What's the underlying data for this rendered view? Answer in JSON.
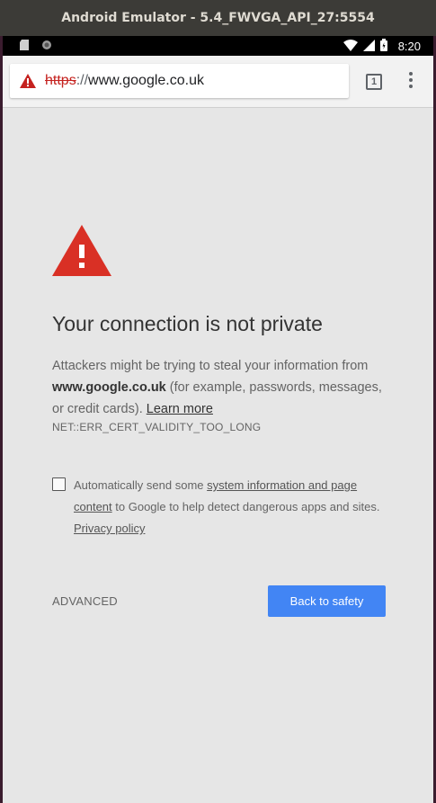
{
  "window": {
    "title": "Android Emulator - 5.4_FWVGA_API_27:5554"
  },
  "status_bar": {
    "time": "8:20",
    "icons": [
      "sd-card-icon",
      "record-icon",
      "wifi-icon",
      "signal-icon",
      "battery-icon"
    ]
  },
  "browser": {
    "url_scheme": "https",
    "url_separator": "://",
    "url_host": "www.google.co.uk",
    "tab_count": "1",
    "icons": [
      "not-secure-warning-icon",
      "tab-switcher-icon",
      "overflow-menu-icon"
    ]
  },
  "interstitial": {
    "heading": "Your connection is not private",
    "body_prefix": "Attackers might be trying to steal your information from",
    "body_host": "www.google.co.uk",
    "body_suffix": "(for example, passwords, messages, or credit cards).",
    "learn_more": "Learn more",
    "error_code": "NET::ERR_CERT_VALIDITY_TOO_LONG",
    "checkbox_prefix": "Automatically send some",
    "checkbox_link": "system information and page content",
    "checkbox_suffix": "to Google to help detect dangerous apps and sites.",
    "privacy_policy": "Privacy policy",
    "advanced_label": "ADVANCED",
    "back_label": "Back to safety"
  },
  "colors": {
    "accent_blue": "#4285f4",
    "warning_red": "#d93025",
    "page_background": "#e6e6e6"
  }
}
